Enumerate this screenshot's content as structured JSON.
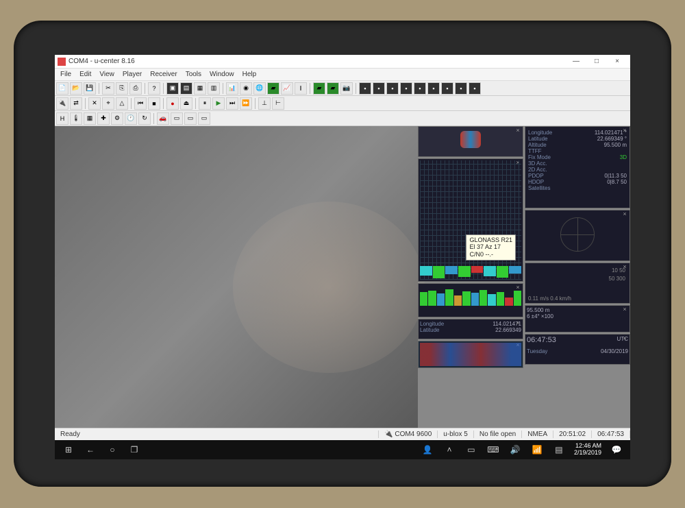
{
  "window": {
    "title": "COM4 - u-center 8.16",
    "min": "—",
    "max": "□",
    "close": "×"
  },
  "menu": {
    "file": "File",
    "edit": "Edit",
    "view": "View",
    "player": "Player",
    "receiver": "Receiver",
    "tools": "Tools",
    "window": "Window",
    "help": "Help"
  },
  "tooltip": {
    "sat": "GLONASS R21",
    "elaz": "El 37 Az 17",
    "cn0": "C/N0 --.-"
  },
  "info": {
    "longitude_label": "Longitude",
    "longitude": "114.021471 °",
    "latitude_label": "Latitude",
    "latitude": "22.669349 °",
    "altitude_label": "Altitude",
    "altitude": "95.500 m",
    "ttff_label": "TTFF",
    "ttff": "",
    "fixmode_label": "Fix Mode",
    "fixmode": "3D",
    "acc3d_label": "3D Acc.",
    "acc3d": "",
    "acc2d_label": "2D Acc.",
    "acc2d": "",
    "pdop_label": "PDOP",
    "pdop": "0|11.3  50",
    "hdop_label": "HDOP",
    "hdop": "0|8.7   50",
    "sats_label": "Satellites",
    "sats": ""
  },
  "dial": {
    "speed": "10 50",
    "speed2": "50   300",
    "readout": "0.11 m/s  0.4 km/h"
  },
  "altbox": {
    "alt": "95.500 m",
    "scale": "6 ±4°   ×100"
  },
  "clock": {
    "time": "06:47:53",
    "tz": "UTC",
    "day": "Tuesday",
    "date": "04/30/2019"
  },
  "lonlat2": {
    "lon_label": "Longitude",
    "lon": "114.021471",
    "lat_label": "Latitude",
    "lat": "22.669349"
  },
  "status": {
    "ready": "Ready",
    "port": "COM4 9600",
    "device": "u-blox 5",
    "file": "No file open",
    "proto": "NMEA",
    "t1": "20:51:02",
    "t2": "06:47:53"
  },
  "taskbar": {
    "time": "12:46 AM",
    "date": "2/19/2019"
  }
}
